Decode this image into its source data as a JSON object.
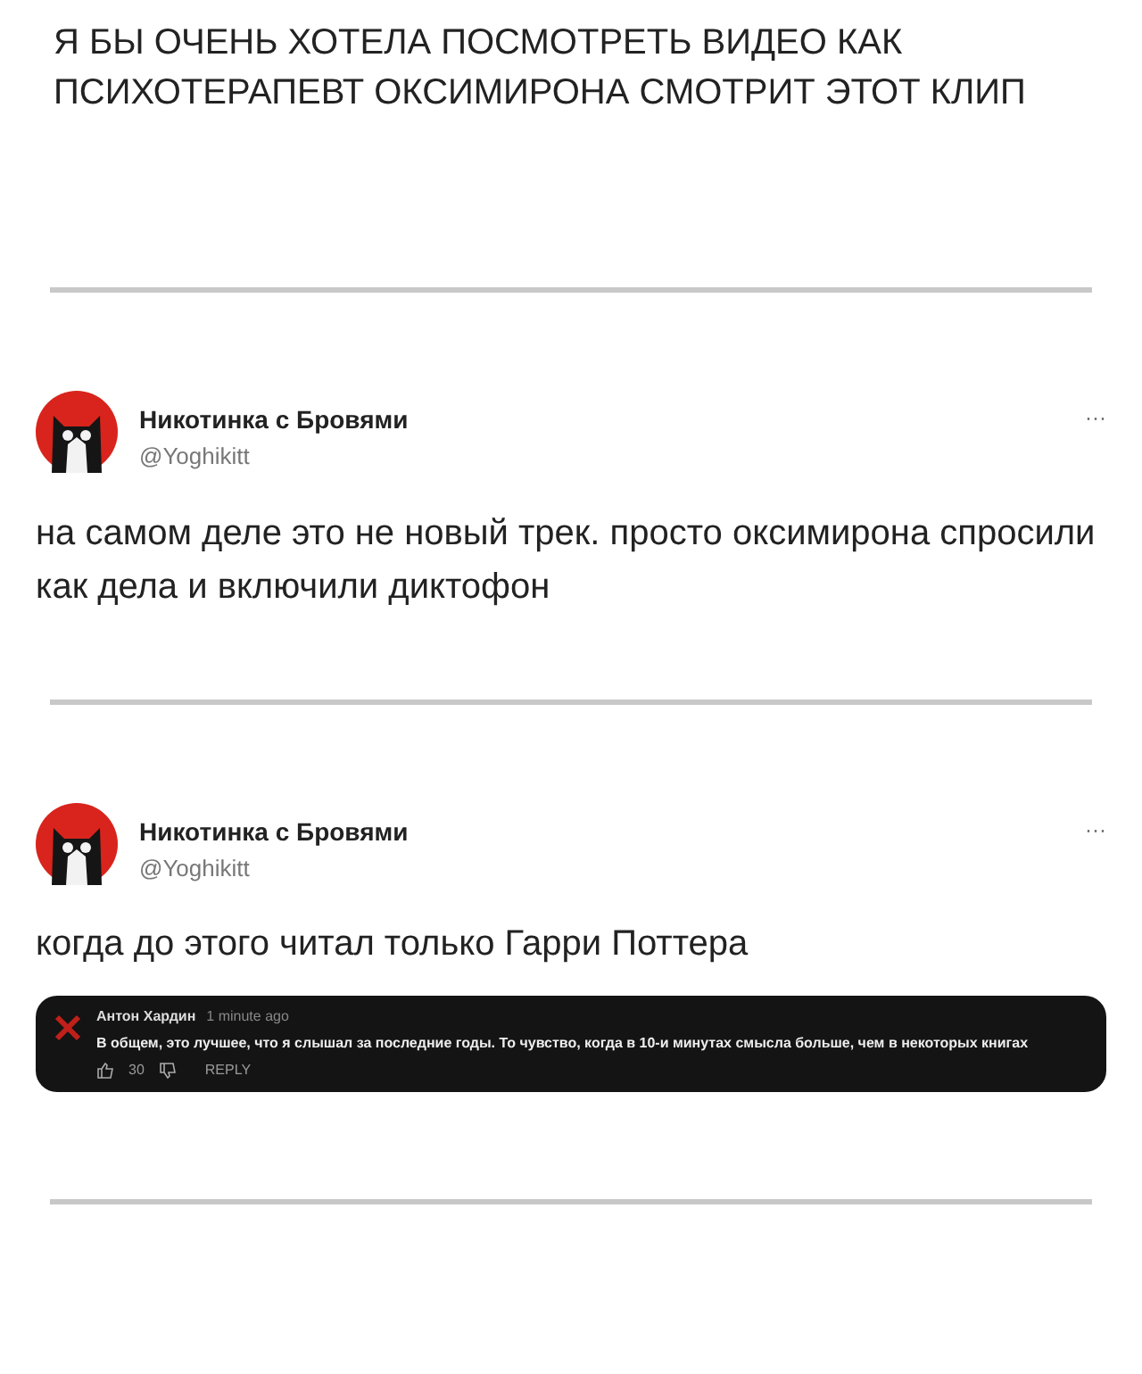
{
  "caption": "Я БЫ ОЧЕНЬ ХОТЕЛА ПОСМОТРЕТЬ ВИДЕО КАК ПСИХОТЕРАПЕВТ ОКСИМИРОНА СМОТРИТ ЭТОТ КЛИП",
  "tweets": [
    {
      "name": "Никотинка с Бровями",
      "handle": "@Yoghikitt",
      "more": "···",
      "text": "на самом деле это не новый трек. просто оксимирона спросили как дела и включили диктофон"
    },
    {
      "name": "Никотинка с Бровями",
      "handle": "@Yoghikitt",
      "more": "···",
      "text": "когда до этого читал только Гарри Поттера",
      "comment": {
        "author": "Антон Хардин",
        "time": "1 minute ago",
        "text": "В общем, это лучшее, что я слышал за последние годы. То чувство, когда в 10-и минутах смысла больше, чем в некоторых книгах",
        "likes": "30",
        "reply": "REPLY"
      }
    }
  ]
}
